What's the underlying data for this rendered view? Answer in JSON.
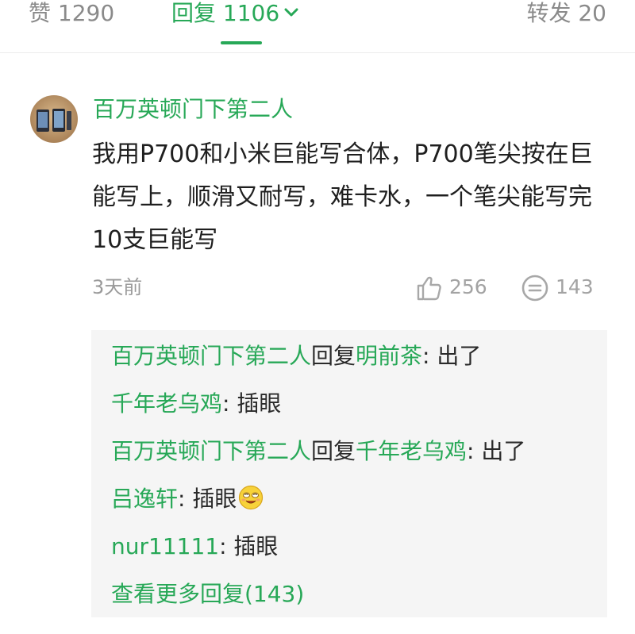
{
  "tabs": {
    "likes_label": "赞 1290",
    "replies_label": "回复 1106",
    "shares_label": "转发 20"
  },
  "comment": {
    "author": "百万英顿门下第二人",
    "text": "我用P700和小米巨能写合体，P700笔尖按在巨能写上，顺滑又耐写，难卡水，一个笔尖能写完10支巨能写",
    "time": "3天前",
    "like_count": "256",
    "reply_count": "143"
  },
  "replies": [
    {
      "user": "百万英顿门下第二人",
      "verb": "回复",
      "target": "明前茶",
      "text": ": 出了"
    },
    {
      "user": "千年老乌鸡",
      "text": ": 插眼"
    },
    {
      "user": "百万英顿门下第二人",
      "verb": "回复",
      "target": "千年老乌鸡",
      "text": ": 出了"
    },
    {
      "user": "吕逸轩",
      "text": ": 插眼",
      "emoji": "smiley-emoji"
    },
    {
      "user": "nur11111",
      "text": ": 插眼"
    }
  ],
  "more_replies_label": "查看更多回复(143)",
  "colors": {
    "accent_green": "#27a857",
    "muted_gray": "#9a9a9a",
    "reply_bg": "#f5f5f5"
  },
  "icons": [
    "chevron-down-icon",
    "thumbs-up-icon",
    "comment-icon",
    "smiley-emoji"
  ]
}
